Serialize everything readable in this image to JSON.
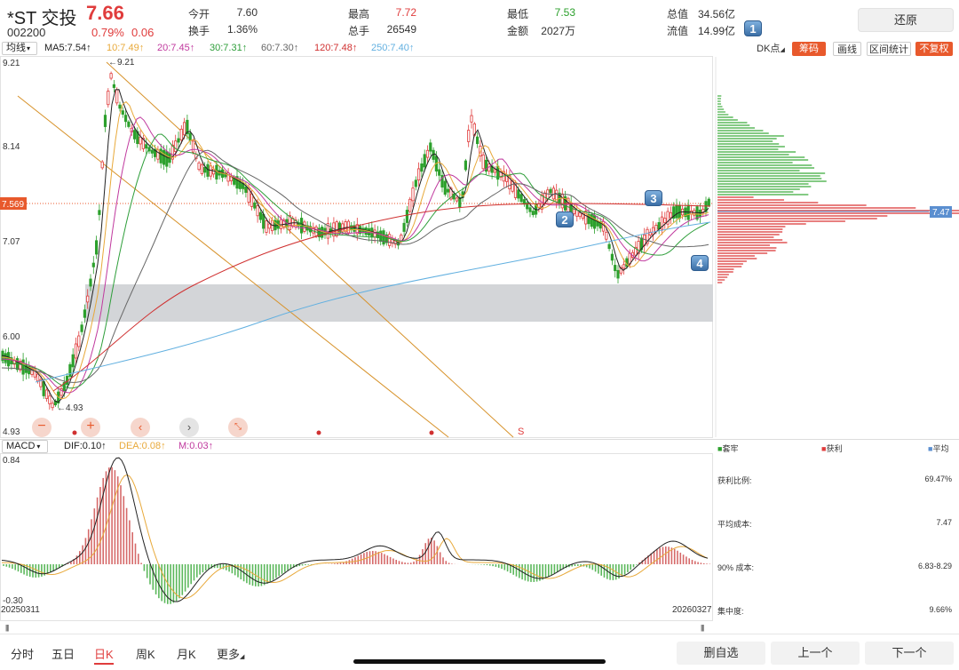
{
  "stock": {
    "name": "*ST 交投",
    "price": "7.66",
    "code": "002200",
    "change_pct": "0.79%",
    "change": "0.06"
  },
  "quote": {
    "open_label": "今开",
    "open": "7.60",
    "turnover_label": "换手",
    "turnover": "1.36%",
    "high_label": "最高",
    "high": "7.72",
    "volume_label": "总手",
    "volume": "26549",
    "low_label": "最低",
    "low": "7.53",
    "amount_label": "金额",
    "amount": "2027万",
    "mktcap_label": "总值",
    "mktcap": "34.56亿",
    "float_label": "流值",
    "float": "14.99亿"
  },
  "badges": {
    "b1": "1",
    "b2": "2",
    "b3": "3",
    "b4": "4"
  },
  "restore_button": "还原",
  "ma_bar": {
    "dropdown": "均线",
    "items": [
      {
        "text": "MA5:7.54↑",
        "color": "#222222"
      },
      {
        "text": "10:7.49↑",
        "color": "#e8a93a"
      },
      {
        "text": "20:7.45↑",
        "color": "#c0399e"
      },
      {
        "text": "30:7.31↑",
        "color": "#2e9e3a"
      },
      {
        "text": "60:7.30↑",
        "color": "#666666"
      },
      {
        "text": "120:7.48↑",
        "color": "#d03131"
      },
      {
        "text": "250:7.40↑",
        "color": "#62b0e0"
      }
    ],
    "dk_label": "DK点",
    "chip_button": "筹码",
    "draw_button": "画线",
    "range_button": "区间统计",
    "noadj_button": "不复权"
  },
  "price_axis": {
    "top": "9.21",
    "mid1": "8.14",
    "cur": "7.569",
    "mid2": "7.07",
    "mid3": "6.00",
    "bottom": "4.93"
  },
  "annotations": {
    "high_mark": "←9.21",
    "low_mark": "←4.93",
    "right_price": "7.47",
    "s_mark": "S"
  },
  "macd": {
    "dropdown": "MACD",
    "dif": "DIF:0.10↑",
    "dea": "DEA:0.08↑",
    "m": "M:0.03↑",
    "top": "0.84",
    "bottom": "-0.30",
    "date_start": "20250311",
    "date_end": "20260327"
  },
  "colors": {
    "up": "#e03c3c",
    "down": "#2ca02c",
    "accent": "#e8592c"
  },
  "chip_panel": {
    "legend_trapped": "套牢",
    "legend_profit": "获利",
    "legend_avg": "平均",
    "profit_ratio_label": "获利比例:",
    "profit_ratio": "69.47%",
    "avg_cost_label": "平均成本:",
    "avg_cost": "7.47",
    "cost90_label": "90% 成本:",
    "cost90": "6.83-8.29",
    "concentration_label": "集中度:",
    "concentration": "9.66%"
  },
  "nav": {
    "tabs": [
      "分时",
      "五日",
      "日K",
      "周K",
      "月K",
      "更多"
    ],
    "active_tab": "日K",
    "delete_button": "删自选",
    "prev_button": "上一个",
    "next_button": "下一个"
  }
}
